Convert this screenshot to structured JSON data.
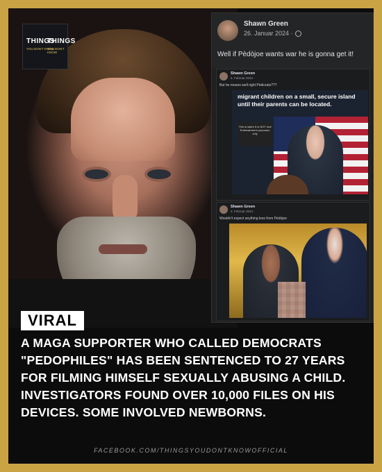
{
  "logo": {
    "word_left": "THINGS",
    "word_right": "THINGS",
    "tagline_left": "YOU DON'T KNOW",
    "tagline_right": "YOU DON'T KNOW"
  },
  "facebook_post": {
    "author": "Shawn Green",
    "date": "26. Januar 2024 ·",
    "text": "Well if Pèdòjoe wants war he is gonna get it!"
  },
  "repost_1": {
    "author": "Shawn Green",
    "date": "5. Februar 2024 ·",
    "text": "But he means well right Pèdicrats???",
    "news_headline": "migrant children on a small, secure island until their parents can be located.",
    "bubble_text": "This is satire It is NOT real Entertainment purposes only"
  },
  "repost_2": {
    "author": "Shawn Green",
    "date": "2. Februar 2024 ·",
    "text": "Wouldn't expect anything less from Pèdòjoe"
  },
  "badge": "VIRAL",
  "headline": "A MAGA SUPPORTER WHO CALLED DEMOCRATS \"PEDOPHILES\" HAS BEEN SENTENCED TO 27 YEARS FOR FILMING HIMSELF SEXUALLY ABUSING A CHILD. INVESTIGATORS FOUND OVER 10,000 FILES ON HIS DEVICES. SOME INVOLVED NEWBORNS.",
  "footer": "FACEBOOK.COM/THINGSYOUDONTKNOWOFFICIAL",
  "colors": {
    "frame": "#caa444",
    "background": "#0c0c0c",
    "fb_panel": "#242526"
  }
}
